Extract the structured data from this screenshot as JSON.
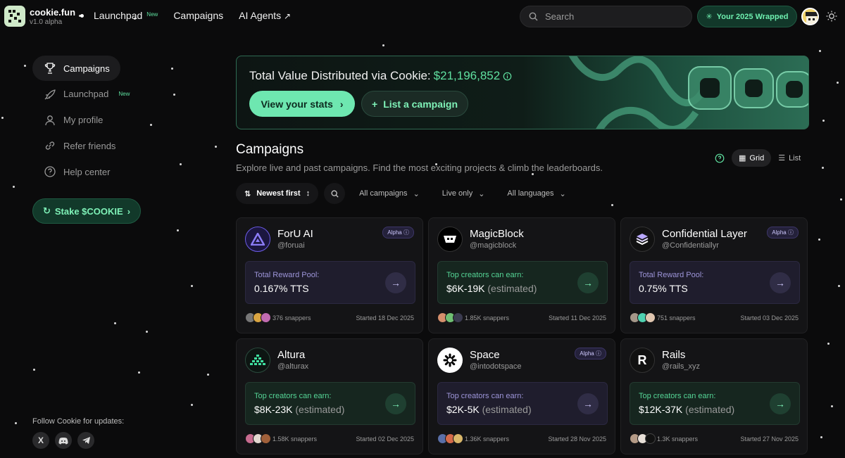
{
  "brand": {
    "name": "cookie.fun",
    "version": "v1.0 alpha"
  },
  "nav": {
    "launchpad": "Launchpad",
    "launchpad_badge": "New",
    "campaigns": "Campaigns",
    "ai_agents": "AI Agents"
  },
  "search": {
    "placeholder": "Search"
  },
  "wrapped": {
    "label": "Your 2025 Wrapped"
  },
  "sidebar": {
    "items": [
      {
        "label": "Campaigns",
        "icon": "trophy-icon"
      },
      {
        "label": "Launchpad",
        "icon": "rocket-icon",
        "badge": "New"
      },
      {
        "label": "My profile",
        "icon": "user-icon"
      },
      {
        "label": "Refer friends",
        "icon": "link-icon"
      },
      {
        "label": "Help center",
        "icon": "help-icon"
      }
    ],
    "stake_label": "Stake $COOKIE",
    "follow_label": "Follow Cookie for updates:"
  },
  "banner": {
    "title": "Total Value Distributed via Cookie:",
    "amount": "$21,196,852",
    "stats_button": "View your stats",
    "list_button": "List a campaign"
  },
  "campaigns": {
    "title": "Campaigns",
    "subtitle": "Explore live and past campaigns. Find the most exciting projects & climb the leaderboards.",
    "grid_label": "Grid",
    "list_label": "List",
    "filters": {
      "sort": "Newest first",
      "all_campaigns": "All campaigns",
      "live_only": "Live only",
      "all_languages": "All languages"
    },
    "cards": [
      {
        "name": "ForU AI",
        "handle": "@foruai",
        "alpha": "Alpha",
        "pool_label": "Total Reward Pool:",
        "pool_value": "0.167% TTS",
        "estimated": "",
        "theme": "purple",
        "snappers": "376 snappers",
        "started": "Started 18 Dec 2025"
      },
      {
        "name": "MagicBlock",
        "handle": "@magicblock",
        "alpha": "",
        "pool_label": "Top creators can earn:",
        "pool_value": "$6K-19K",
        "estimated": "(estimated)",
        "theme": "green",
        "snappers": "1.85K snappers",
        "started": "Started 11 Dec 2025"
      },
      {
        "name": "Confidential Layer",
        "handle": "@Confidentiallyr",
        "alpha": "Alpha",
        "pool_label": "Total Reward Pool:",
        "pool_value": "0.75% TTS",
        "estimated": "",
        "theme": "purple",
        "snappers": "751 snappers",
        "started": "Started 03 Dec 2025"
      },
      {
        "name": "Altura",
        "handle": "@alturax",
        "alpha": "",
        "pool_label": "Top creators can earn:",
        "pool_value": "$8K-23K",
        "estimated": "(estimated)",
        "theme": "green",
        "snappers": "1.58K snappers",
        "started": "Started 02 Dec 2025"
      },
      {
        "name": "Space",
        "handle": "@intodotspace",
        "alpha": "Alpha",
        "pool_label": "Top creators can earn:",
        "pool_value": "$2K-5K",
        "estimated": "(estimated)",
        "theme": "purple",
        "snappers": "1.36K snappers",
        "started": "Started 28 Nov 2025"
      },
      {
        "name": "Rails",
        "handle": "@rails_xyz",
        "alpha": "",
        "pool_label": "Top creators can earn:",
        "pool_value": "$12K-37K",
        "estimated": "(estimated)",
        "theme": "green",
        "snappers": "1.3K snappers",
        "started": "Started 27 Nov 2025"
      }
    ]
  },
  "colors": {
    "accent": "#6ee7b0",
    "alpha_purple": "#9d95d9",
    "background": "#0b0b0c"
  }
}
